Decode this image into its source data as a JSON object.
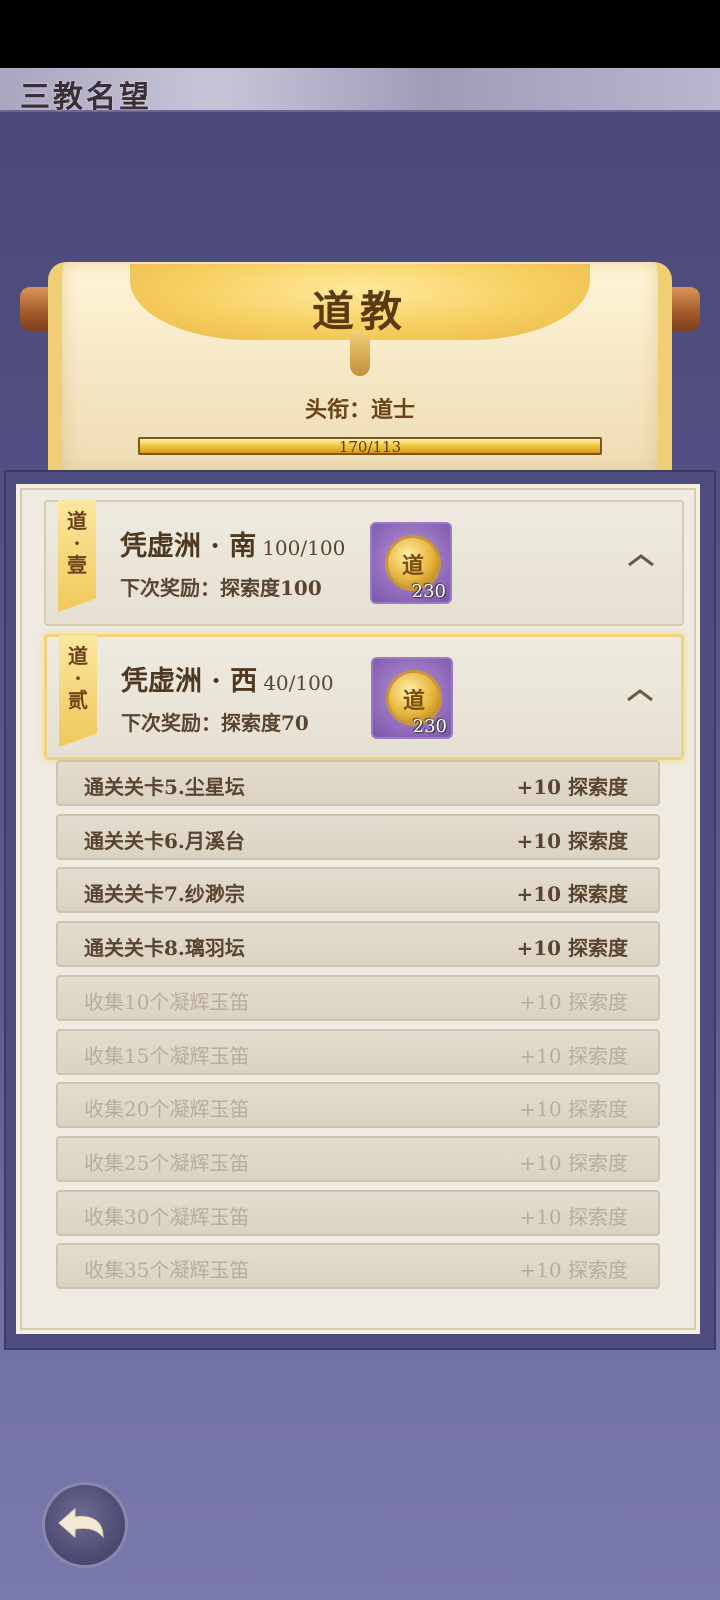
{
  "page": {
    "title": "三教名望"
  },
  "scroll": {
    "sect_title": "道教",
    "rank_label": "头衔：道士",
    "progress_text": "170/113",
    "progress_fraction": 1.0
  },
  "regions": [
    {
      "tag": "道·壹",
      "name": "凭虚洲 · 南",
      "progress": "100/100",
      "next_reward": "下次奖励：探索度100",
      "reward_char": "道",
      "reward_count": "230"
    },
    {
      "tag": "道·贰",
      "name": "凭虚洲 · 西",
      "progress": "40/100",
      "next_reward": "下次奖励：探索度70",
      "reward_char": "道",
      "reward_count": "230"
    }
  ],
  "tasks": [
    {
      "name": "通关关卡5.尘星坛",
      "reward": "+10 探索度",
      "locked": false
    },
    {
      "name": "通关关卡6.月溪台",
      "reward": "+10 探索度",
      "locked": false
    },
    {
      "name": "通关关卡7.纱渺宗",
      "reward": "+10 探索度",
      "locked": false
    },
    {
      "name": "通关关卡8.璃羽坛",
      "reward": "+10 探索度",
      "locked": false
    },
    {
      "name": "收集10个凝辉玉笛",
      "reward": "+10 探索度",
      "locked": true
    },
    {
      "name": "收集15个凝辉玉笛",
      "reward": "+10 探索度",
      "locked": true
    },
    {
      "name": "收集20个凝辉玉笛",
      "reward": "+10 探索度",
      "locked": true
    },
    {
      "name": "收集25个凝辉玉笛",
      "reward": "+10 探索度",
      "locked": true
    },
    {
      "name": "收集30个凝辉玉笛",
      "reward": "+10 探索度",
      "locked": true
    },
    {
      "name": "收集35个凝辉玉笛",
      "reward": "+10 探索度",
      "locked": true
    }
  ],
  "icons": {
    "back": "back-arrow-icon",
    "collapse": "chevron-up-icon"
  },
  "colors": {
    "accent_gold": "#f1c53b",
    "text_brown": "#5a4530",
    "background_purple": "#5d5b8f"
  }
}
